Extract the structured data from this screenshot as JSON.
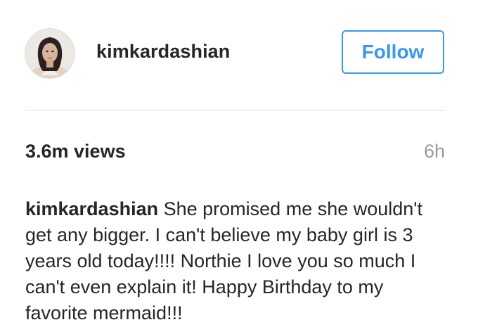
{
  "post": {
    "username": "kimkardashian",
    "follow_label": "Follow",
    "views": "3.6m views",
    "time": "6h",
    "caption_username": "kimkardashian",
    "caption_text": "She promised me she wouldn't get any bigger. I can't believe my baby girl is 3 years old today!!!! Northie I love you so much I can't even explain it! Happy Birthday to my favorite mermaid!!!"
  },
  "colors": {
    "accent": "#3897f0",
    "text": "#262626",
    "muted": "#999999",
    "divider": "#efefef"
  },
  "icons": {
    "avatar": "profile-photo"
  }
}
